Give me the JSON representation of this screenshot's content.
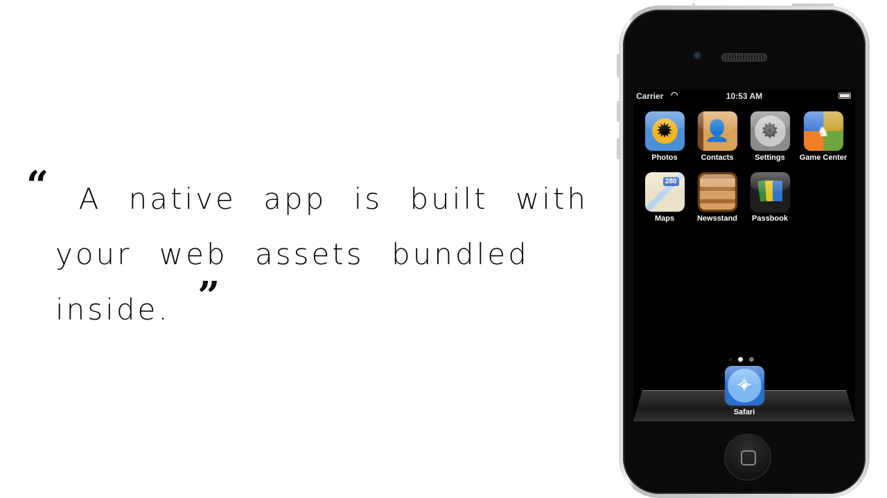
{
  "quote": {
    "open_mark": "“",
    "line1": "A native app is built with",
    "line2": "your web assets bundled inside.",
    "close_mark": "”"
  },
  "status_bar": {
    "carrier": "Carrier",
    "time": "10:53 AM",
    "wifi_icon": "wifi-icon",
    "battery_icon": "battery-icon"
  },
  "home_screen": {
    "apps": [
      {
        "label": "Photos",
        "icon": "photos-icon"
      },
      {
        "label": "Contacts",
        "icon": "contacts-icon"
      },
      {
        "label": "Settings",
        "icon": "settings-icon"
      },
      {
        "label": "Game Center",
        "icon": "game-center-icon"
      },
      {
        "label": "Maps",
        "icon": "maps-icon",
        "badge": "280"
      },
      {
        "label": "Newsstand",
        "icon": "newsstand-icon"
      },
      {
        "label": "Passbook",
        "icon": "passbook-icon"
      }
    ],
    "page_indicator": {
      "pages": 2,
      "current": 1,
      "has_search_page": true
    },
    "dock": [
      {
        "label": "Safari",
        "icon": "safari-icon"
      }
    ]
  }
}
